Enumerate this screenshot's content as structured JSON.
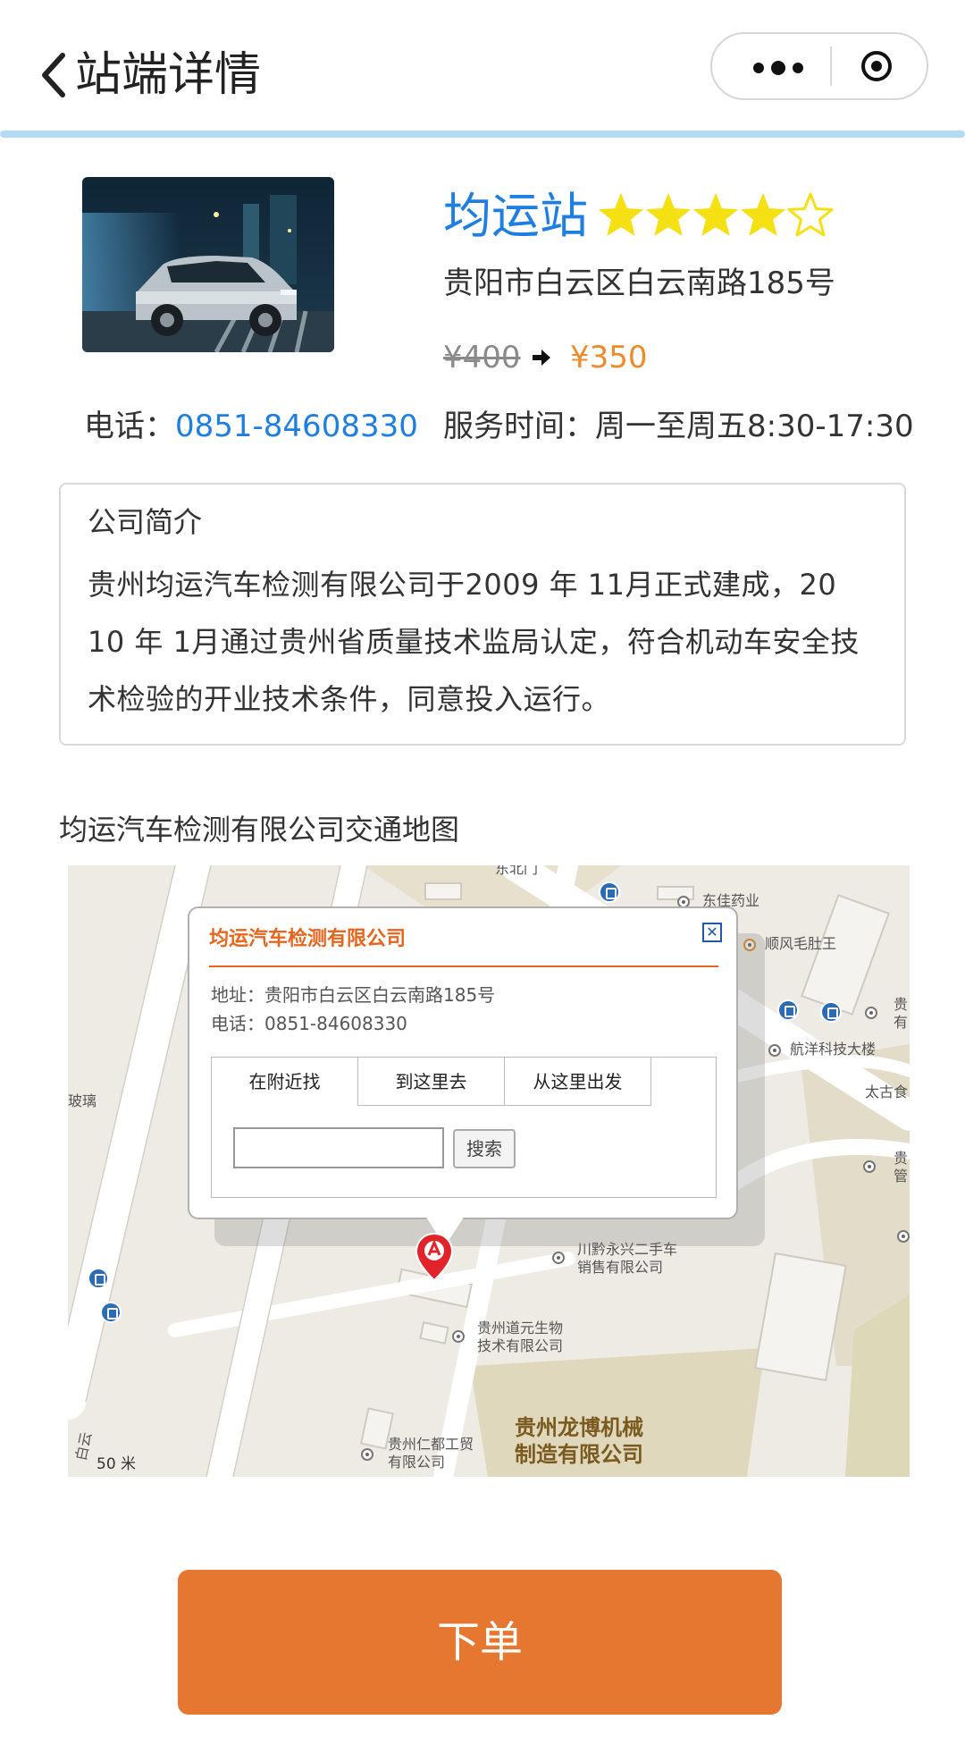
{
  "nav": {
    "title": "站端详情",
    "back_icon": "chevron-left-icon",
    "more_icon": "more-dots-icon",
    "close_icon": "target-close-icon"
  },
  "station": {
    "name": "均运站",
    "rating": 4,
    "rating_max": 5,
    "star_color": "#f5e014",
    "address": "贵阳市白云区白云南路185号",
    "original_price": "¥400",
    "price": "¥350",
    "phone_label": "电话：",
    "phone": "0851-84608330",
    "hours_label": "服务时间：",
    "hours": "周一至周五8:30-17:30"
  },
  "intro": {
    "title": "公司简介",
    "text": "贵州均运汽车检测有限公司于2009 年 11月正式建成，20 10 年 1月通过贵州省质量技术监局认定，符合机动车安全技术检验的开业技术条件，同意投入运行。"
  },
  "map": {
    "title": "均运汽车检测有限公司交通地图",
    "popup": {
      "title": "均运汽车检测有限公司",
      "address": "地址：贵阳市白云区白云南路185号",
      "phone": "电话：0851-84608330",
      "tabs": [
        "在附近找",
        "到这里去",
        "从这里出发"
      ],
      "search_button": "搜索",
      "search_value": ""
    },
    "labels": {
      "east_gate": "东北门",
      "pharmacy": "东佳药业",
      "shunfeng": "顺风毛肚王",
      "hangyang": "航洋科技大楼",
      "taigu": "太古食",
      "gui": "贵",
      "guan": "管",
      "you": "有",
      "glass": "玻璃",
      "chuanqian_1": "川黔永兴二手车",
      "chuanqian_2": "销售有限公司",
      "daoyuan_1": "贵州道元生物",
      "daoyuan_2": "技术有限公司",
      "longbo_1": "贵州龙博机械",
      "longbo_2": "制造有限公司",
      "rendu_1": "贵州仁都工贸",
      "rendu_2": "有限公司",
      "road": "白云",
      "scale": "50 米"
    }
  },
  "order_button": "下单",
  "colors": {
    "accent_blue": "#1e7fe0",
    "price_orange": "#ef8a2b",
    "order_button": "#e67730",
    "map_popup_title": "#e8651e"
  }
}
